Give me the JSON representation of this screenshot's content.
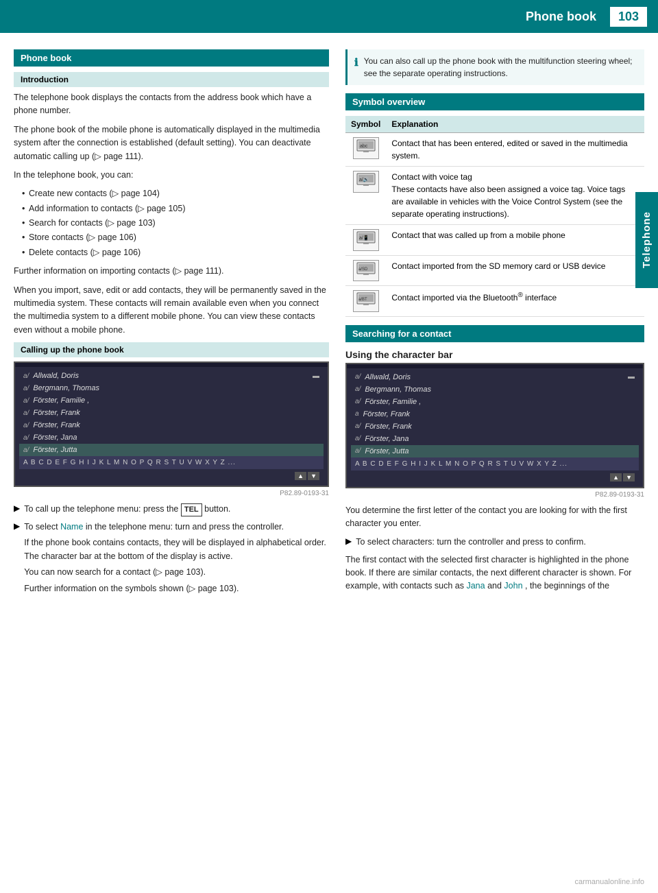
{
  "header": {
    "title": "Phone book",
    "page_number": "103"
  },
  "side_tab": {
    "label": "Telephone"
  },
  "left_col": {
    "section_title": "Phone book",
    "subsection_intro": "Introduction",
    "intro_para1": "The telephone book displays the contacts from the address book which have a phone number.",
    "intro_para2": "The phone book of the mobile phone is automatically displayed in the multimedia system after the connection is established (default setting). You can deactivate automatic calling up (▷ page 111).",
    "intro_para3": "In the telephone book, you can:",
    "bullet_items": [
      "Create new contacts (▷ page 104)",
      "Add information to contacts (▷ page 105)",
      "Search for contacts (▷ page 103)",
      "Store contacts (▷ page 106)",
      "Delete contacts (▷ page 106)"
    ],
    "further_info": "Further information on importing contacts (▷ page 111).",
    "import_para": "When you import, save, edit or add contacts, they will be permanently saved in the multimedia system. These contacts will remain available even when you connect the multimedia system to a different mobile phone. You can view these contacts even without a mobile phone.",
    "subsection_calling": "Calling up the phone book",
    "contacts": [
      "Allwald, Doris",
      "Bergmann, Thomas",
      "Förster, Familie ,",
      "Förster, Frank",
      "Förster, Frank",
      "Förster, Jana",
      "Förster, Jutta"
    ],
    "char_bar": "A B C D E F G H I J K L M N O P Q R S T U V W X Y Z ...",
    "screen_label": "P82.89-0193-31",
    "instr1_arrow": "▶",
    "instr1_text": "To call up the telephone menu: press the",
    "tel_badge": "TEL",
    "instr1_suffix": "button.",
    "instr2_arrow": "▶",
    "instr2_text_1": "To select",
    "instr2_name": "Name",
    "instr2_text_2": "in the telephone menu: turn and press the controller.",
    "instr2_text_3": "If the phone book contains contacts, they will be displayed in alphabetical order. The character bar at the bottom of the display is active.",
    "instr2_text_4": "You can now search for a contact (▷ page 103).",
    "instr2_text_5": "Further information on the symbols shown (▷ page 103)."
  },
  "right_col": {
    "info_box_text": "You can also call up the phone book with the multifunction steering wheel; see the separate operating instructions.",
    "symbol_section_title": "Symbol overview",
    "symbol_col1": "Symbol",
    "symbol_col2": "Explanation",
    "symbols": [
      {
        "icon": "🖥",
        "icon_label": "multimedia-icon",
        "description": "Contact that has been entered, edited or saved in the multimedia system."
      },
      {
        "icon": "🔊",
        "icon_label": "voice-tag-icon",
        "description": "Contact with voice tag\nThese contacts have also been assigned a voice tag. Voice tags are available in vehicles with the Voice Control System (see the separate operating instructions)."
      },
      {
        "icon": "📱",
        "icon_label": "mobile-phone-icon",
        "description": "Contact that was called up from a mobile phone"
      },
      {
        "icon": "💾",
        "icon_label": "sd-card-icon",
        "description": "Contact imported from the SD memory card or USB device"
      },
      {
        "icon": "🔵",
        "icon_label": "bluetooth-icon",
        "description": "Contact imported via the Bluetooth® interface"
      }
    ],
    "search_section_title": "Searching for a contact",
    "char_bar_heading": "Using the character bar",
    "contacts2": [
      "Allwald, Doris",
      "Bergmann, Thomas",
      "Förster, Familie ,",
      "Förster, Frank",
      "Förster, Frank",
      "Förster, Jana",
      "Förster, Jutta"
    ],
    "screen_label2": "P82.89-0193-31",
    "search_para1": "You determine the first letter of the contact you are looking for with the first character you enter.",
    "search_instr_arrow": "▶",
    "search_instr_text": "To select characters: turn the controller and press to confirm.",
    "search_para2_1": "The first contact with the selected first character is highlighted in the phone book. If there are similar contacts, the next different character is shown. For example, with contacts such as",
    "search_para2_name1": "Jana",
    "search_para2_and": "and",
    "search_para2_name2": "John",
    "search_para2_2": ", the beginnings of the"
  },
  "watermark": "carmanualonline.info"
}
